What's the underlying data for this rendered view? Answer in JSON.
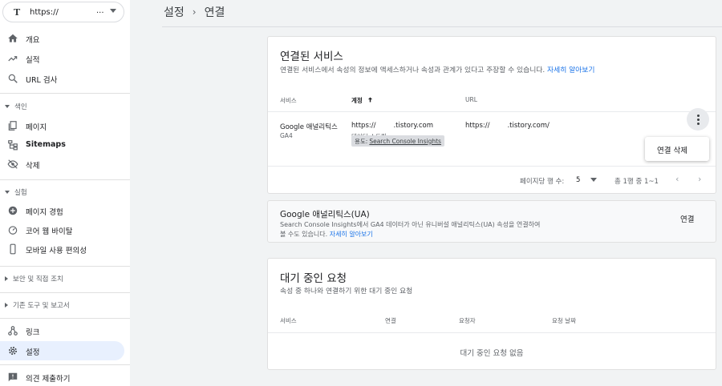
{
  "property": {
    "favicon": "T",
    "url": "https://",
    "masked": "...",
    "caret_icon": "caret-down-icon"
  },
  "sidebar": {
    "items": [
      {
        "label": "개요",
        "icon": "home-icon"
      },
      {
        "label": "실적",
        "icon": "trending-up-icon"
      },
      {
        "label": "URL 검사",
        "icon": "search-icon"
      }
    ],
    "index_section": "색인",
    "index_items": [
      {
        "label": "페이지",
        "icon": "pages-icon"
      },
      {
        "label": "Sitemaps",
        "icon": "sitemap-icon"
      },
      {
        "label": "삭제",
        "icon": "eye-off-icon"
      }
    ],
    "experience_section": "실험",
    "experience_items": [
      {
        "label": "페이지 경험",
        "icon": "plus-circle-icon"
      },
      {
        "label": "코어 웹 바이탈",
        "icon": "gauge-icon"
      },
      {
        "label": "모바일 사용 편의성",
        "icon": "phone-icon"
      }
    ],
    "security_section": "보안 및 직접 조치",
    "legacy_section": "기존 도구 및 보고서",
    "bottom_items": [
      {
        "label": "링크",
        "icon": "links-icon"
      },
      {
        "label": "설정",
        "icon": "gear-icon"
      }
    ],
    "feedback": {
      "label": "의견 제출하기",
      "icon": "feedback-icon"
    }
  },
  "breadcrumb": {
    "parent": "설정",
    "separator": "›",
    "current": "연결"
  },
  "connected": {
    "title": "연결된 서비스",
    "subtitle": "연결된 서비스에서 속성의 정보에 액세스하거나 속성과 관계가 있다고 주장할 수 있습니다. ",
    "learn_more": "자세히 알아보기",
    "columns": {
      "service": "서비스",
      "account": "계정",
      "url": "URL"
    },
    "sort_icon": "arrow-up-icon",
    "row": {
      "service": "Google 애널리틱스",
      "service_type": "GA4",
      "account_prefix": "https://",
      "account_suffix": ".tistory.com",
      "account_sub": "데이터 스트림:",
      "url_prefix": "https://",
      "url_suffix": ".tistory.com/",
      "chip_label": "용도:",
      "chip_link": "Search Console Insights"
    },
    "menu": {
      "remove": "연결 삭제"
    },
    "pagination": {
      "rows_label": "페이지당 행 수:",
      "rows_value": "5",
      "range": "총 1행 중 1~1"
    }
  },
  "ua": {
    "title": "Google 애널리틱스(UA)",
    "line1": "Search Console Insights에서 GA4 데이터가 아닌 유니버설 애널리틱스(UA) 속성을 연결하여",
    "line2": "볼 수도 있습니다. ",
    "learn_more": "자세히 알아보기",
    "connect": "연결"
  },
  "pending": {
    "title": "대기 중인 요청",
    "subtitle": "속성 중 하나와 연결하기 위한 대기 중인 요청",
    "columns": {
      "service": "서비스",
      "link": "연결",
      "requester": "요청자",
      "date": "요청 날짜"
    },
    "empty": "대기 중인 요청 없음"
  },
  "colors": {
    "accent": "#1a73e8",
    "active_nav": "#e8f0fe",
    "background": "#f1f3f4"
  }
}
